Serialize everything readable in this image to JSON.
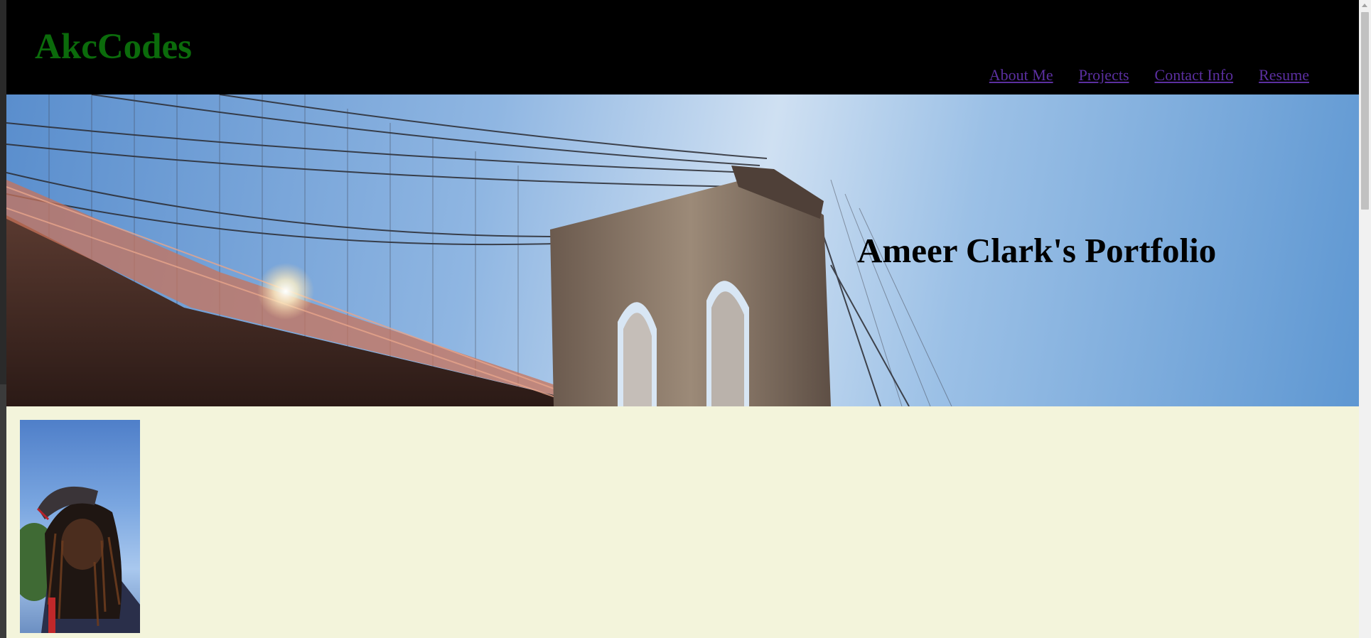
{
  "header": {
    "brand": "AkcCodes",
    "nav": [
      {
        "label": "About Me"
      },
      {
        "label": "Projects"
      },
      {
        "label": "Contact Info"
      },
      {
        "label": "Resume"
      }
    ]
  },
  "hero": {
    "title": "Ameer Clark's Portfolio",
    "image": "brooklyn-bridge-photo"
  },
  "profile": {
    "image": "profile-photo"
  },
  "colors": {
    "header_bg": "#000000",
    "brand": "#0b6b0b",
    "nav_link": "#5b2fa0",
    "page_bg": "#f3f4db"
  }
}
